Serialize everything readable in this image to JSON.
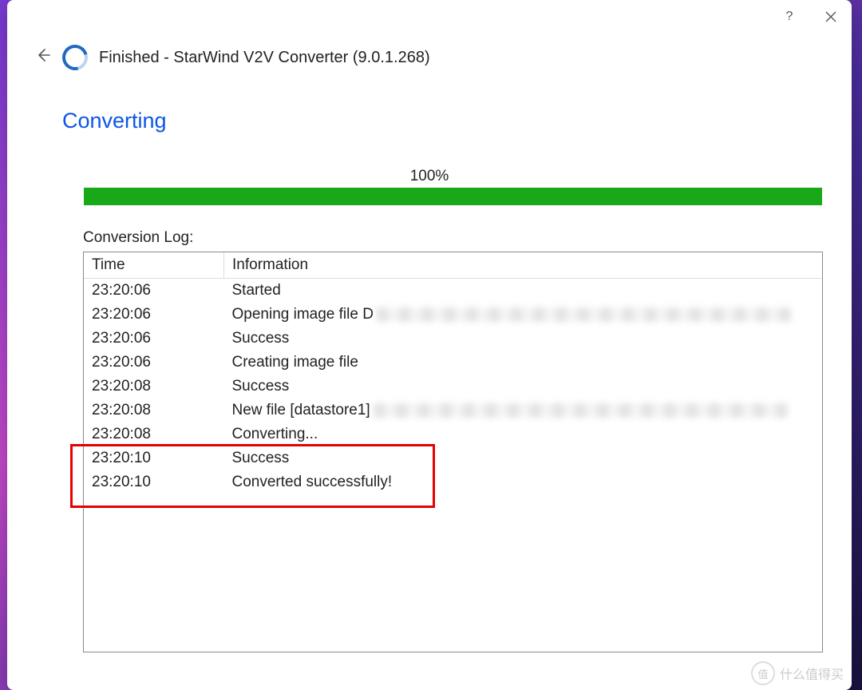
{
  "window": {
    "title": "Finished - StarWind V2V Converter (9.0.1.268)"
  },
  "section_title": "Converting",
  "progress": {
    "percent_label": "100%",
    "percent": 100
  },
  "log": {
    "label": "Conversion Log:",
    "headers": {
      "time": "Time",
      "info": "Information"
    },
    "rows": [
      {
        "time": "23:20:06",
        "info": "Started",
        "redacted": false
      },
      {
        "time": "23:20:06",
        "info": "Opening image file D",
        "redacted": true
      },
      {
        "time": "23:20:06",
        "info": "Success",
        "redacted": false
      },
      {
        "time": "23:20:06",
        "info": "Creating image file",
        "redacted": false
      },
      {
        "time": "23:20:08",
        "info": "Success",
        "redacted": false
      },
      {
        "time": "23:20:08",
        "info": "New file [datastore1]",
        "redacted": true
      },
      {
        "time": "23:20:08",
        "info": "Converting...",
        "redacted": false
      },
      {
        "time": "23:20:10",
        "info": "Success",
        "redacted": false
      },
      {
        "time": "23:20:10",
        "info": "Converted successfully!",
        "redacted": false
      }
    ]
  },
  "watermark": {
    "text": "什么值得买",
    "badge": "值"
  }
}
